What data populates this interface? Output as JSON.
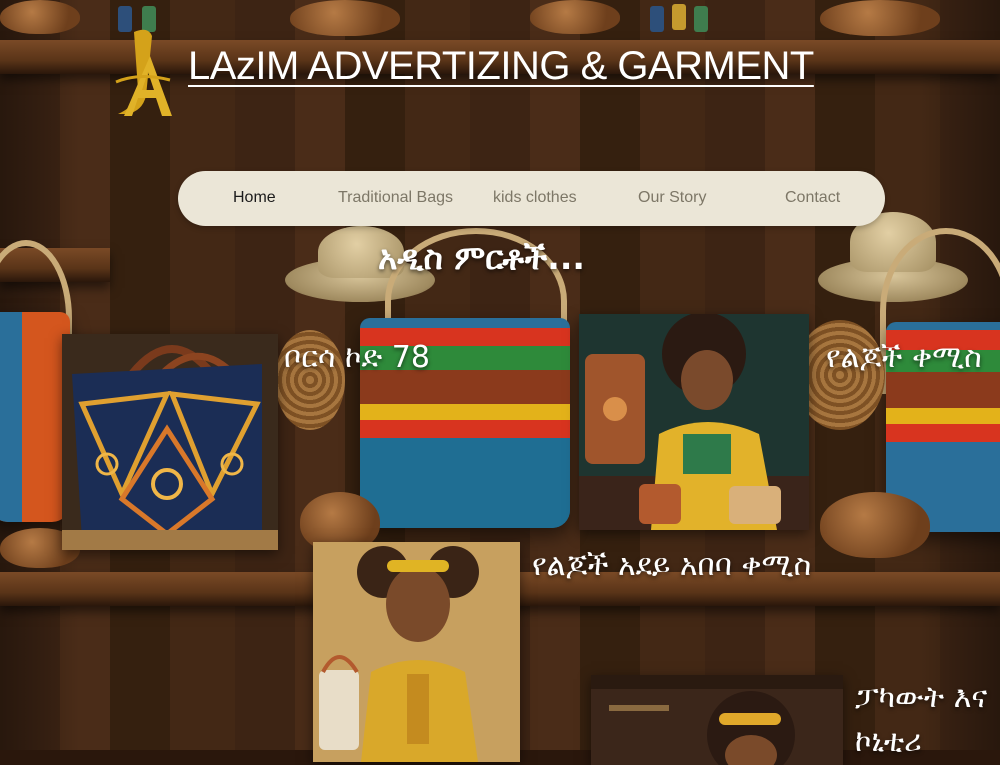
{
  "header": {
    "brand": "LAzIM ADVERTIZING & GARMENT",
    "logo_text": "LA"
  },
  "nav": {
    "items": [
      {
        "label": "Home",
        "active": true
      },
      {
        "label": "Traditional Bags",
        "active": false
      },
      {
        "label": "kids clothes",
        "active": false
      },
      {
        "label": "Our Story",
        "active": false
      },
      {
        "label": "Contact",
        "active": false
      }
    ]
  },
  "main": {
    "headline": "አዲስ ምርቶች...",
    "products": [
      {
        "caption": "ቦርሳ ኮድ 78"
      },
      {
        "caption": "የልጆች ቀሚስ"
      },
      {
        "caption": "የልጆች አደይ አበባ ቀሚስ"
      },
      {
        "caption": "ፓካውት እና"
      },
      {
        "caption": "ኮኒቲሪ"
      }
    ]
  },
  "colors": {
    "nav_bg": "#ebe6d7",
    "nav_text": "#7d7767",
    "nav_active": "#1b1b1b",
    "logo_gold": "#d4a21a",
    "text_white": "#ffffff"
  }
}
